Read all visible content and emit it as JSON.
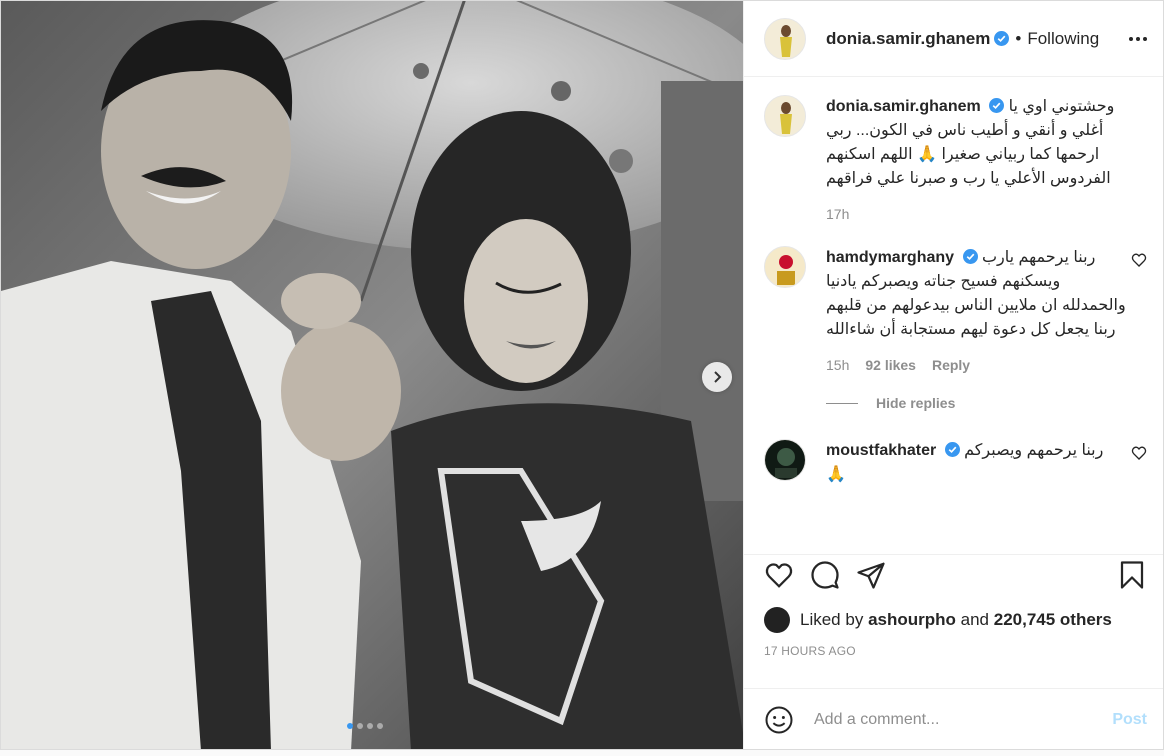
{
  "post": {
    "username": "donia.samir.ghanem",
    "separator": "•",
    "follow_status": "Following",
    "caption": {
      "username": "donia.samir.ghanem",
      "text": "وحشتوني اوي يا أغلي و أنقي و أطيب ناس في الكون... ربي ارحمها كما ربياني صغيرا 🙏 اللهم اسكنهم الفردوس الأعلي يا رب و صبرنا علي فراقهم",
      "time": "17h"
    },
    "comments": [
      {
        "username": "hamdymarghany",
        "text": "ربنا يرحمهم يارب ويسكنهم فسيح جناته ويصبركم يادنيا والحمدلله ان ملايين الناس بيدعولهم من قلبهم ربنا يجعل كل دعوة ليهم مستجابة أن شاءالله",
        "time": "15h",
        "likes": "92 likes",
        "reply": "Reply"
      },
      {
        "username": "moustfakhater",
        "text": "ربنا يرحمهم ويصبركم 🙏"
      }
    ],
    "hide_replies": "Hide replies",
    "liked_by_prefix": "Liked by",
    "liked_by_user": "ashourpho",
    "liked_by_and": "and",
    "liked_by_others": "220,745 others",
    "timestamp": "17 HOURS AGO",
    "add_comment_placeholder": "Add a comment...",
    "post_button": "Post",
    "carousel": {
      "count": 4,
      "active": 1
    },
    "icons": [
      "more-options-icon",
      "verified-badge-icon",
      "heart-icon",
      "comment-icon",
      "share-icon",
      "bookmark-icon",
      "emoji-icon",
      "chevron-right-icon"
    ],
    "colors": {
      "verified": "#3897f0",
      "post_button_disabled": "#b2dffc",
      "muted": "#8e8e8e"
    }
  }
}
